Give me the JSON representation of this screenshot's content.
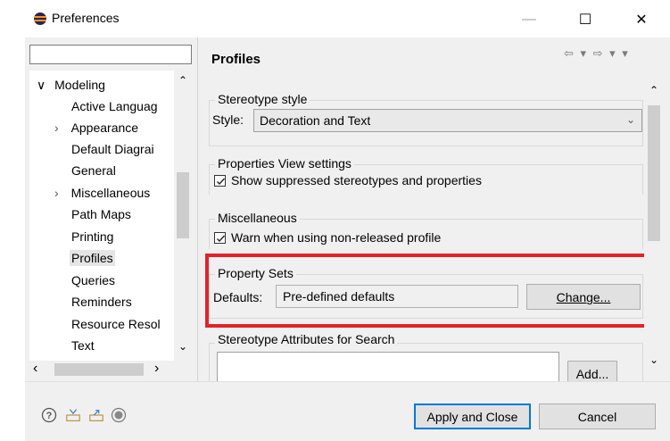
{
  "window": {
    "title": "Preferences",
    "minimize": "—",
    "maximize": "☐",
    "close": "✕"
  },
  "sidebar": {
    "filter_value": "",
    "items": [
      {
        "label": "Modeling",
        "expander": "∨"
      },
      {
        "label": "Active Languag"
      },
      {
        "label": "Appearance",
        "expander": "›"
      },
      {
        "label": "Default Diagrai"
      },
      {
        "label": "General"
      },
      {
        "label": "Miscellaneous",
        "expander": "›"
      },
      {
        "label": "Path Maps"
      },
      {
        "label": "Printing"
      },
      {
        "label": "Profiles"
      },
      {
        "label": "Queries"
      },
      {
        "label": "Reminders"
      },
      {
        "label": "Resource Resol"
      },
      {
        "label": "Text"
      }
    ],
    "scroll_up": "⌃",
    "scroll_down": "⌄",
    "scroll_left": "‹",
    "scroll_right": "›"
  },
  "page": {
    "title": "Profiles",
    "nav": "⇦ ▾ ⇨ ▾ ▾"
  },
  "stereotype_style": {
    "group_label": "Stereotype style",
    "style_label": "Style:",
    "style_value": "Decoration and Text"
  },
  "properties_view": {
    "group_label": "Properties View settings",
    "checkbox_label": "Show suppressed stereotypes and properties",
    "checked": true
  },
  "miscellaneous": {
    "group_label": "Miscellaneous",
    "checkbox_label": "Warn when using non-released profile",
    "checked": true
  },
  "property_sets": {
    "group_label": "Property Sets",
    "defaults_label": "Defaults:",
    "defaults_value": "Pre-defined defaults",
    "change_button": "Change..."
  },
  "stereotype_search": {
    "group_label": "Stereotype Attributes for Search",
    "add_button": "Add..."
  },
  "footer": {
    "apply_close": "Apply and Close",
    "cancel": "Cancel"
  },
  "colors": {
    "highlight": "#e2232a",
    "focus": "#0078d7"
  }
}
